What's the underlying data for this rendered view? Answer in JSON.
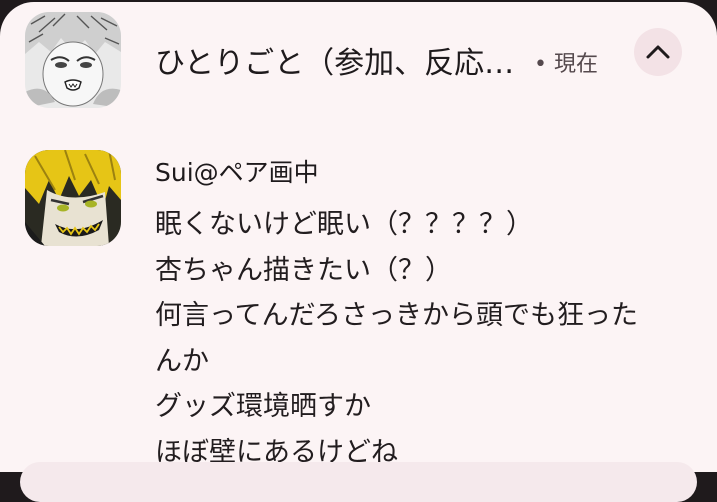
{
  "notification": {
    "group_title": "ひとりごと（参加、反応…",
    "meta": "• 現在",
    "collapse_icon": "chevron-up-icon",
    "sender": "Sui@ペア画中",
    "messages": [
      "眠くないけど眠い（？？？？）",
      "杏ちゃん描きたい（？）",
      "何言ってんだろさっきから頭でも狂った",
      "んか",
      "グッズ環境晒すか",
      "ほぼ壁にあるけどね"
    ]
  },
  "colors": {
    "card_background": "#fcf4f5",
    "collapse_button_bg": "#f3e2e6",
    "text_primary": "#1e1a1c",
    "text_secondary": "#55494d"
  }
}
